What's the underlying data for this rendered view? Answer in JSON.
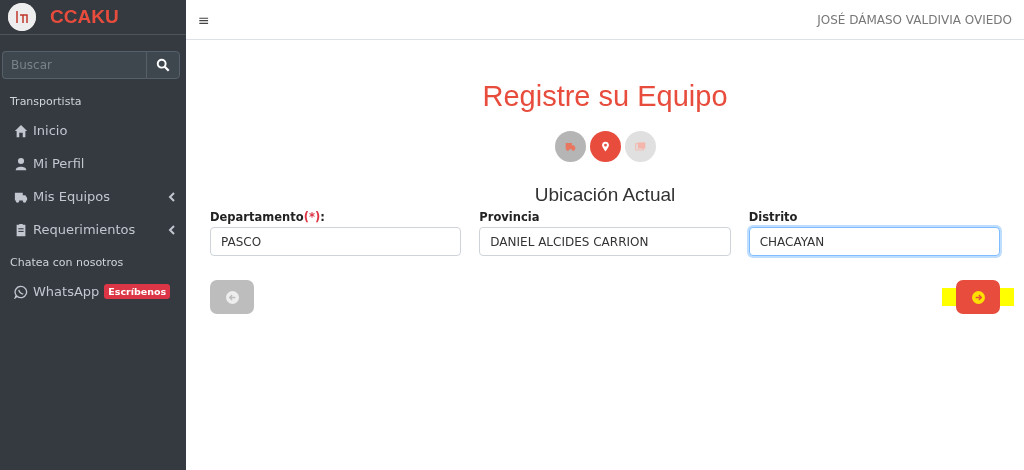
{
  "brand": {
    "name": "CCAKU"
  },
  "sidebar": {
    "search": {
      "placeholder": "Buscar"
    },
    "items": [
      {
        "kind": "header",
        "label": "Transportista"
      },
      {
        "kind": "link",
        "label": "Inicio",
        "expandable": false
      },
      {
        "kind": "link",
        "label": "Mi Perfil",
        "expandable": false
      },
      {
        "kind": "link",
        "label": "Mis Equipos",
        "expandable": true
      },
      {
        "kind": "link",
        "label": "Requerimientos",
        "expandable": true
      },
      {
        "kind": "header",
        "label": "Chatea con nosotros"
      },
      {
        "kind": "link",
        "label": "WhatsApp",
        "badge": "Escríbenos"
      }
    ]
  },
  "topbar": {
    "menu_icon": "≡",
    "user": "JOSÉ DÁMASO VALDIVIA OVIEDO"
  },
  "page": {
    "title": "Registre su Equipo",
    "steps": [
      {
        "selected": false,
        "completed": true
      },
      {
        "selected": true
      },
      {
        "selected": false,
        "completed": false
      }
    ],
    "section_title": "Ubicación Actual",
    "fields": [
      {
        "label": "Departamento",
        "required_mark": "(*)",
        "label_end": ":",
        "value": "PASCO",
        "focused": false
      },
      {
        "label": "Provincia",
        "value": "DANIEL ALCIDES CARRION",
        "focused": false
      },
      {
        "label": "Distrito",
        "value": "CHACAYAN",
        "focused": true
      }
    ],
    "back_button": {
      "disabled": true
    },
    "next_button": {
      "disabled": false,
      "highlighted": true
    }
  }
}
